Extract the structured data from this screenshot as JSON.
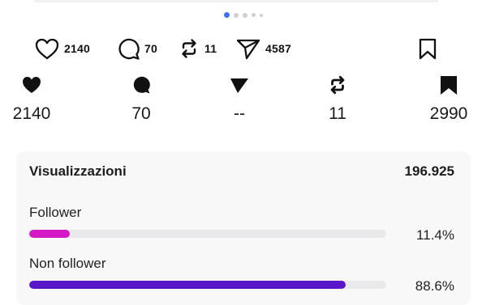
{
  "carousel": {
    "dot_count": 5,
    "active_index": 0,
    "active_color": "#3b71f3"
  },
  "actions": {
    "like": {
      "icon": "heart-outline-icon",
      "count": "2140"
    },
    "comment": {
      "icon": "comment-outline-icon",
      "count": "70"
    },
    "repost": {
      "icon": "repost-icon",
      "count": "11"
    },
    "share": {
      "icon": "send-outline-icon",
      "count": "4587"
    },
    "save": {
      "icon": "bookmark-outline-icon"
    }
  },
  "stats": {
    "likes": {
      "icon": "heart-filled-icon",
      "value": "2140"
    },
    "comments": {
      "icon": "comment-filled-icon",
      "value": "70"
    },
    "shares": {
      "icon": "send-filled-icon",
      "value": "--"
    },
    "reposts": {
      "icon": "repost-icon",
      "value": "11"
    },
    "saves": {
      "icon": "bookmark-filled-icon",
      "value": "2990"
    }
  },
  "views": {
    "title": "Visualizzazioni",
    "total": "196.925",
    "breakdown": [
      {
        "label": "Follower",
        "percent_text": "11.4%",
        "fraction": 0.114,
        "color": "#d418c6"
      },
      {
        "label": "Non follower",
        "percent_text": "88.6%",
        "fraction": 0.886,
        "color": "#5a16c8"
      }
    ]
  }
}
